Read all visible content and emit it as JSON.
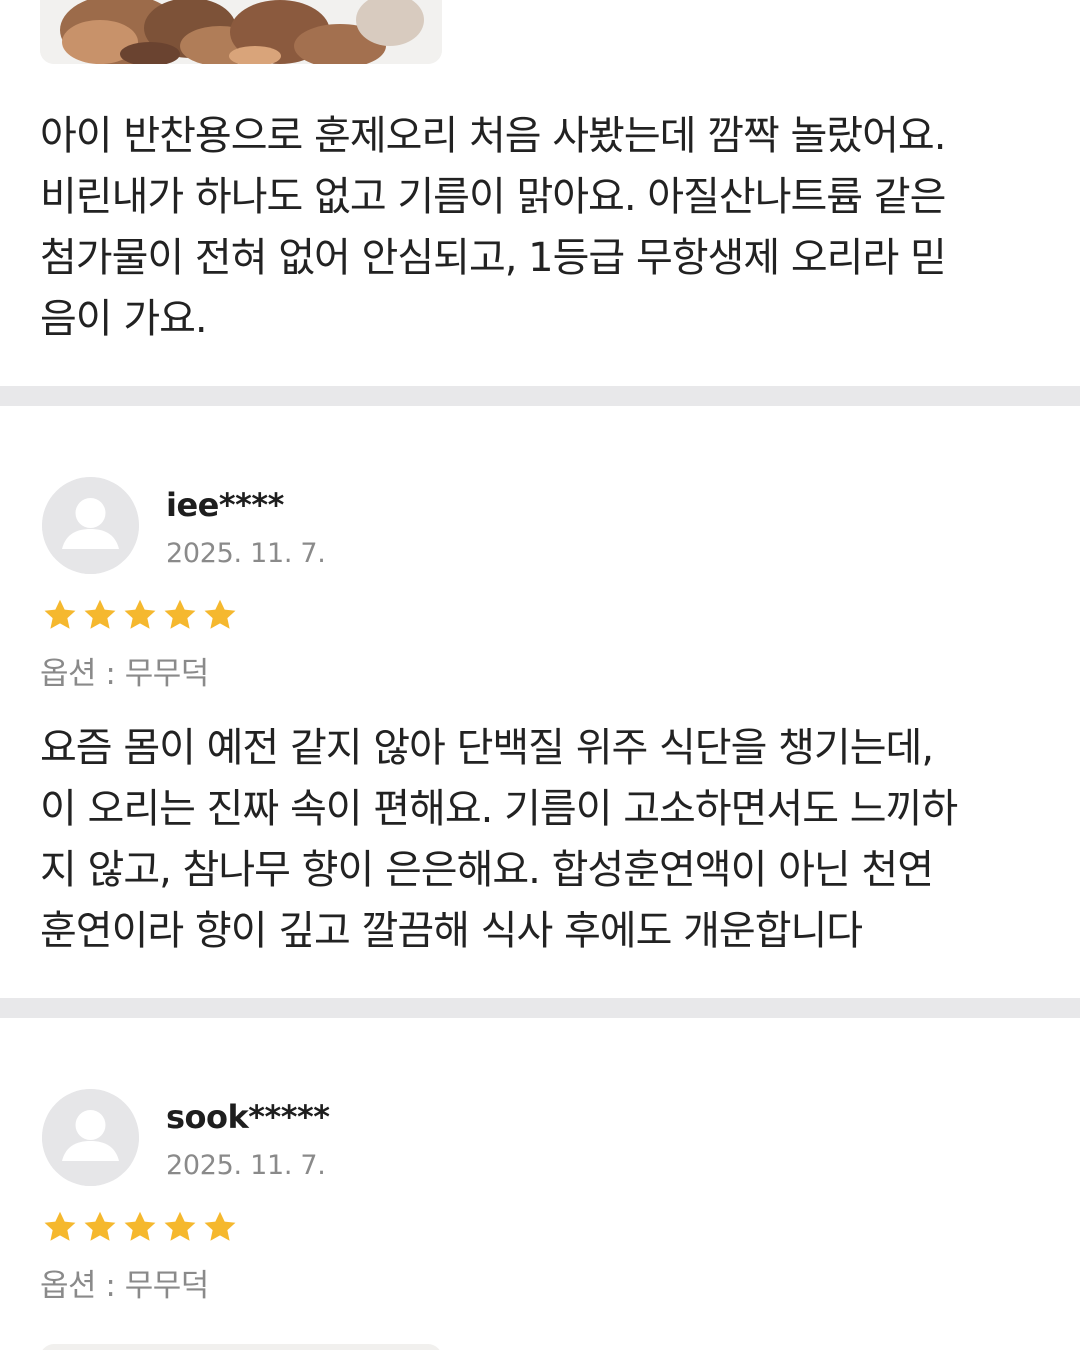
{
  "reviews": [
    {
      "text": "아이 반찬용으로 훈제오리 처음 사봤는데 깜짝 놀랐어요.\n비린내가 하나도 없고 기름이 맑아요. 아질산나트륨 같은\n첨가물이 전혀 없어 안심되고, 1등급 무항생제 오리라 믿\n음이 가요."
    },
    {
      "username": "iee****",
      "date": "2025. 11. 7.",
      "rating": 5,
      "option": "옵션 : 무무덕",
      "text": "요즘 몸이 예전 같지 않아 단백질 위주 식단을 챙기는데,\n이 오리는 진짜 속이 편해요. 기름이 고소하면서도 느끼하\n지 않고, 참나무 향이 은은해요. 합성훈연액이 아닌 천연\n훈연이라 향이 깊고 깔끔해 식사 후에도 개운합니다"
    },
    {
      "username": "sook*****",
      "date": "2025. 11. 7.",
      "rating": 5,
      "option": "옵션 : 무무덕"
    }
  ],
  "colors": {
    "star": "#f5b82e",
    "divider": "#e8e8ea",
    "avatar_bg": "#e6e6e8",
    "avatar_fg": "#ffffff",
    "muted_text": "#8a8a8a"
  },
  "icons": {
    "avatar": "user-silhouette-icon",
    "star": "star-icon"
  }
}
